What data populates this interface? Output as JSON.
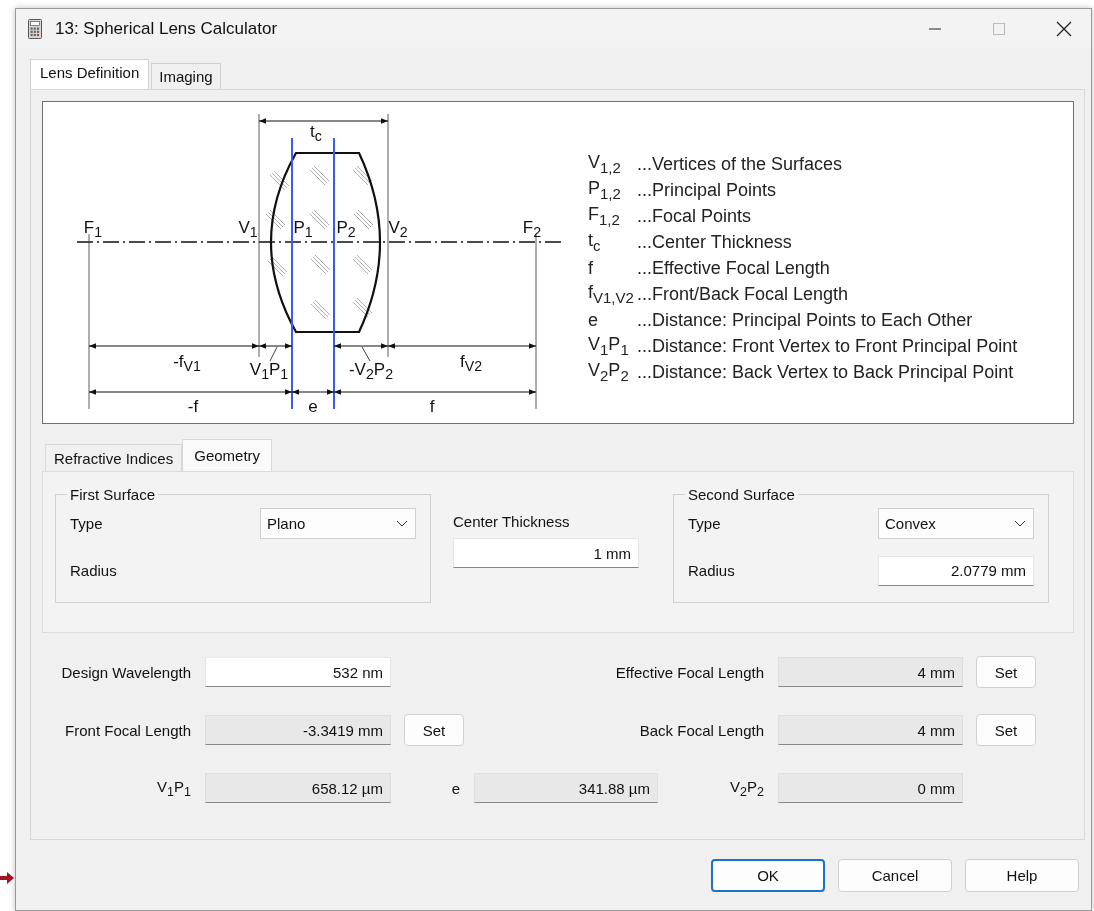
{
  "window": {
    "title": "13: Spherical Lens Calculator"
  },
  "tabs": [
    {
      "label": "Lens Definition",
      "selected": true
    },
    {
      "label": "Imaging",
      "selected": false
    }
  ],
  "diagram": {
    "labels": [
      "t$_{c}$",
      "F$_{1}$",
      "V$_{1}$",
      "P$_{1}$",
      "P$_{2}$",
      "V$_{2}$",
      "F$_{2}$",
      "-f$_{V1}$",
      "V$_{1}$P$_{1}$",
      "-V$_{2}$P$_{2}$",
      "f$_{V2}$",
      "-f",
      "e",
      "f"
    ]
  },
  "legend": [
    {
      "symbol": "V$_{1,2}$",
      "text": "...Vertices of the Surfaces"
    },
    {
      "symbol": "P$_{1,2}$",
      "text": "...Principal Points"
    },
    {
      "symbol": "F$_{1,2}$",
      "text": "...Focal Points"
    },
    {
      "symbol": "t$_{c}$",
      "text": "...Center Thickness"
    },
    {
      "symbol": "f",
      "text": "...Effective Focal Length"
    },
    {
      "symbol": "f$_{V1,V2}$",
      "text": "...Front/Back Focal Length"
    },
    {
      "symbol": "e",
      "text": "...Distance: Principal Points to Each Other"
    },
    {
      "symbol": "V$_{1}$P$_{1}$",
      "text": "...Distance: Front Vertex to Front Principal Point"
    },
    {
      "symbol": "V$_{2}$P$_{2}$",
      "text": "...Distance: Back Vertex to Back Principal Point"
    }
  ],
  "subtabs": [
    {
      "label": "Refractive Indices",
      "selected": false
    },
    {
      "label": "Geometry",
      "selected": true
    }
  ],
  "first_surface": {
    "title": "First Surface",
    "type_label": "Type",
    "type_value": "Plano",
    "radius_label": "Radius"
  },
  "center_thickness": {
    "label": "Center Thickness",
    "value": "1 mm"
  },
  "second_surface": {
    "title": "Second Surface",
    "type_label": "Type",
    "type_value": "Convex",
    "radius_label": "Radius",
    "radius_value": "2.0779 mm"
  },
  "form_rows": [
    {
      "left": {
        "label": "Design Wavelength",
        "value": "532 nm",
        "editable": true
      },
      "right": {
        "label": "Effective Focal Length",
        "value": "4 mm",
        "editable": false,
        "button": "Set"
      }
    },
    {
      "left": {
        "label": "Front Focal Length",
        "value": "-3.3419 mm",
        "editable": false,
        "button": "Set"
      },
      "right": {
        "label": "Back Focal Length",
        "value": "4 mm",
        "editable": false,
        "button": "Set"
      }
    },
    {
      "left": {
        "label": "V$_{1}$P$_{1}$",
        "value": "658.12 µm",
        "editable": false
      },
      "middle": {
        "label": "e",
        "value": "341.88 µm",
        "editable": false
      },
      "right": {
        "label": "V$_{2}$P$_{2}$",
        "value": "0 mm",
        "editable": false
      }
    }
  ],
  "buttons": [
    {
      "label": "OK",
      "default": true
    },
    {
      "label": "Cancel",
      "default": false
    },
    {
      "label": "Help",
      "default": false
    }
  ]
}
